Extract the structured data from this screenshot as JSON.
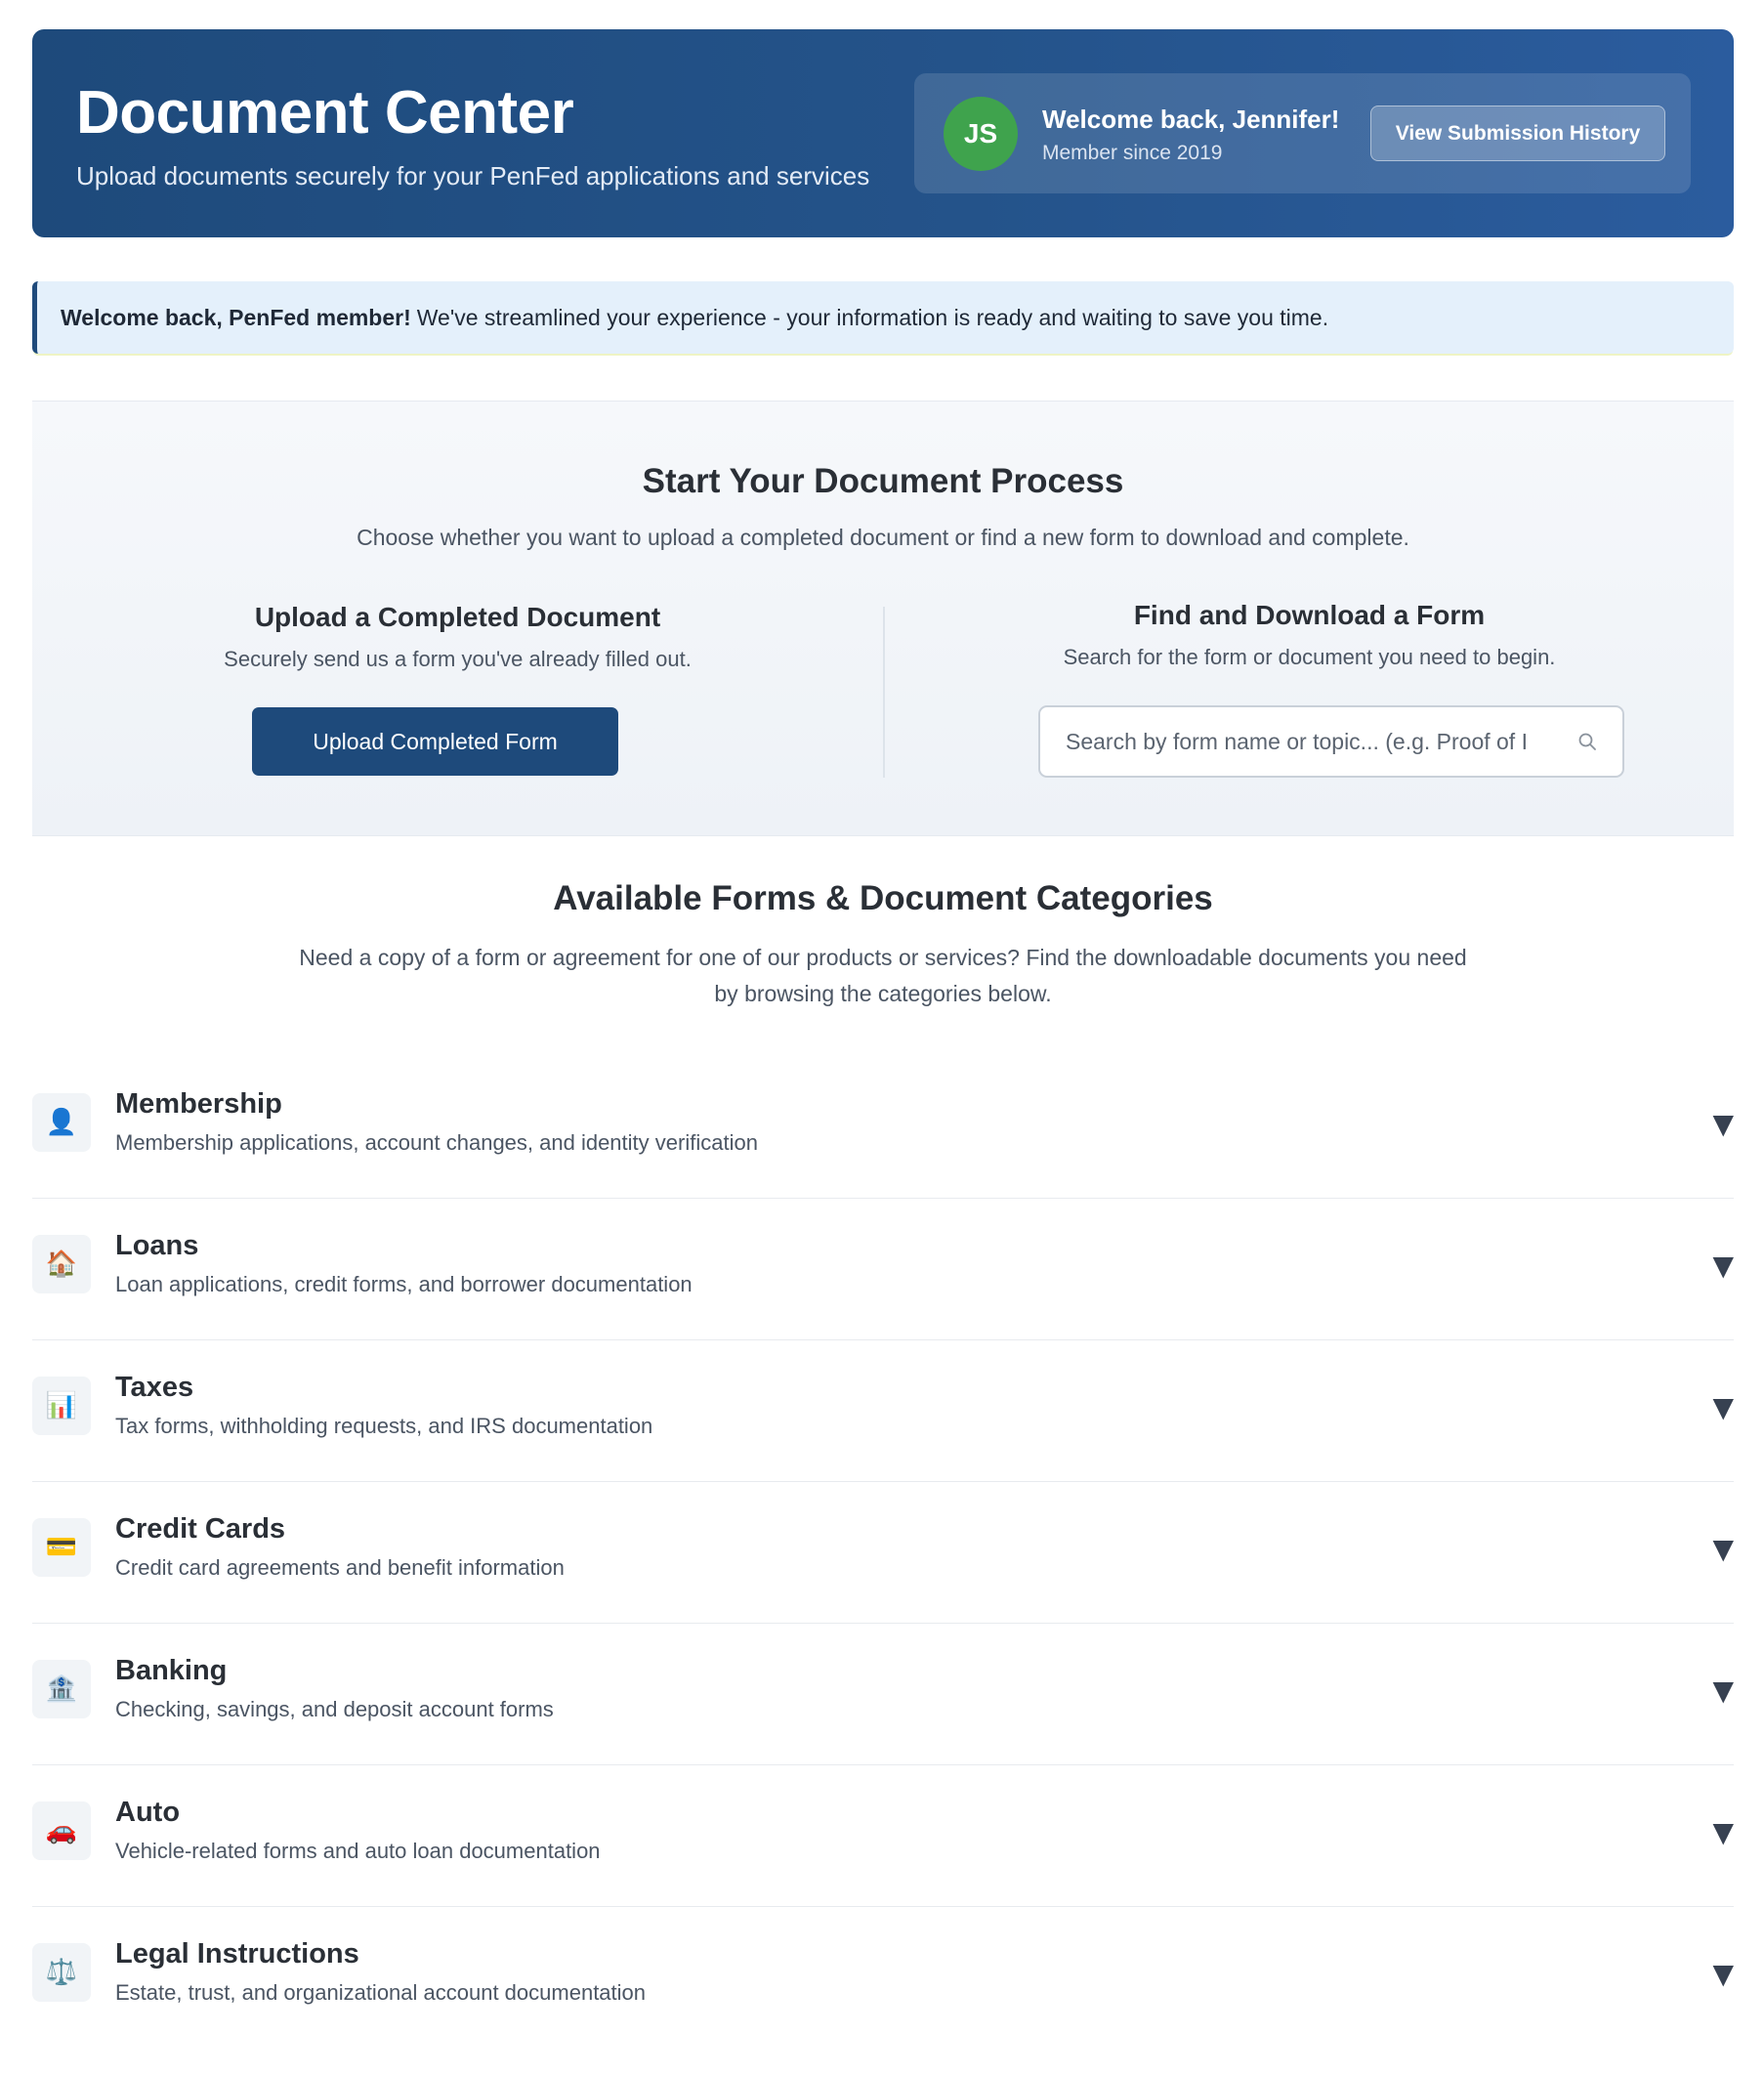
{
  "header": {
    "title": "Document Center",
    "subtitle": "Upload documents securely for your PenFed applications and services",
    "user": {
      "initials": "JS",
      "welcome": "Welcome back, Jennifer!",
      "member_since": "Member since 2019",
      "history_button": "View Submission History"
    }
  },
  "banner": {
    "bold": "Welcome back, PenFed member!",
    "text": "We've streamlined your experience - your information is ready and waiting to save you time."
  },
  "process": {
    "title": "Start Your Document Process",
    "subtitle": "Choose whether you want to upload a completed document or find a new form to download and complete.",
    "upload": {
      "title": "Upload a Completed Document",
      "subtitle": "Securely send us a form you've already filled out.",
      "button": "Upload Completed Form"
    },
    "find": {
      "title": "Find and Download a Form",
      "subtitle": "Search for the form or document you need to begin.",
      "search_placeholder": "Search by form name or topic... (e.g. Proof of I",
      "search_value": ""
    }
  },
  "categories": {
    "title": "Available Forms & Document Categories",
    "subtitle": "Need a copy of a form or agreement for one of our products or services? Find the downloadable documents you need by browsing the categories below.",
    "items": [
      {
        "icon": "person-icon",
        "glyph": "👤",
        "name": "Membership",
        "desc": "Membership applications, account changes, and identity verification"
      },
      {
        "icon": "house-icon",
        "glyph": "🏠",
        "name": "Loans",
        "desc": "Loan applications, credit forms, and borrower documentation"
      },
      {
        "icon": "bar-chart-icon",
        "glyph": "📊",
        "name": "Taxes",
        "desc": "Tax forms, withholding requests, and IRS documentation"
      },
      {
        "icon": "credit-card-icon",
        "glyph": "💳",
        "name": "Credit Cards",
        "desc": "Credit card agreements and benefit information"
      },
      {
        "icon": "bank-icon",
        "glyph": "🏦",
        "name": "Banking",
        "desc": "Checking, savings, and deposit account forms"
      },
      {
        "icon": "car-icon",
        "glyph": "🚗",
        "name": "Auto",
        "desc": "Vehicle-related forms and auto loan documentation"
      },
      {
        "icon": "scales-icon",
        "glyph": "⚖️",
        "name": "Legal Instructions",
        "desc": "Estate, trust, and organizational account documentation"
      }
    ],
    "chevron_glyph": "▼"
  },
  "colors": {
    "header_bg": "#1e4a7b",
    "primary_button": "#1e4a7b",
    "avatar_bg": "#3fa34d",
    "banner_bg": "#e4f0fb"
  }
}
